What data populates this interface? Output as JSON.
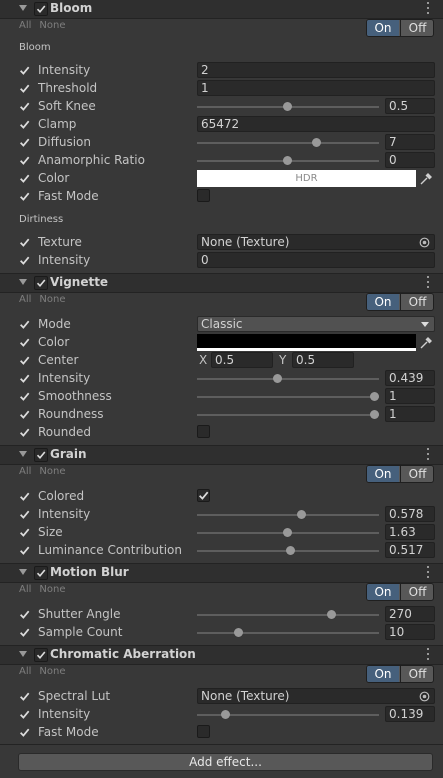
{
  "common": {
    "all": "All",
    "none": "None",
    "on": "On",
    "off": "Off"
  },
  "bloom": {
    "title": "Bloom",
    "group": "Bloom",
    "intensity_label": "Intensity",
    "intensity": "2",
    "threshold_label": "Threshold",
    "threshold": "1",
    "softknee_label": "Soft Knee",
    "softknee": "0.5",
    "softknee_level": 0.5,
    "clamp_label": "Clamp",
    "clamp": "65472",
    "diffusion_label": "Diffusion",
    "diffusion": "7",
    "diffusion_level": 0.63,
    "anamorphic_label": "Anamorphic Ratio",
    "anamorphic": "0",
    "anamorphic_level": 0.5,
    "color_label": "Color",
    "color_text": "HDR",
    "color_value": "#ffffff",
    "fastmode_label": "Fast Mode",
    "dirt_group": "Dirtiness",
    "texture_label": "Texture",
    "texture": "None (Texture)",
    "dirt_intensity_label": "Intensity",
    "dirt_intensity": "0"
  },
  "vignette": {
    "title": "Vignette",
    "mode_label": "Mode",
    "mode": "Classic",
    "color_label": "Color",
    "color_value": "#000000",
    "center_label": "Center",
    "center_x_label": "X",
    "center_x": "0.5",
    "center_y_label": "Y",
    "center_y": "0.5",
    "intensity_label": "Intensity",
    "intensity": "0.439",
    "intensity_level": 0.439,
    "smoothness_label": "Smoothness",
    "smoothness": "1",
    "smoothness_level": 1,
    "roundness_label": "Roundness",
    "roundness": "1",
    "roundness_level": 1,
    "rounded_label": "Rounded"
  },
  "grain": {
    "title": "Grain",
    "colored_label": "Colored",
    "intensity_label": "Intensity",
    "intensity": "0.578",
    "intensity_level": 0.578,
    "size_label": "Size",
    "size": "1.63",
    "size_level": 0.5,
    "luminance_label": "Luminance Contribution",
    "luminance": "0.517",
    "luminance_level": 0.517
  },
  "motionblur": {
    "title": "Motion Blur",
    "shutter_label": "Shutter Angle",
    "shutter": "270",
    "shutter_level": 0.75,
    "samples_label": "Sample Count",
    "samples": "10",
    "samples_level": 0.22
  },
  "chromatic": {
    "title": "Chromatic Aberration",
    "lut_label": "Spectral Lut",
    "lut": "None (Texture)",
    "intensity_label": "Intensity",
    "intensity": "0.139",
    "intensity_level": 0.139,
    "fastmode_label": "Fast Mode"
  },
  "add_effect": "Add effect..."
}
